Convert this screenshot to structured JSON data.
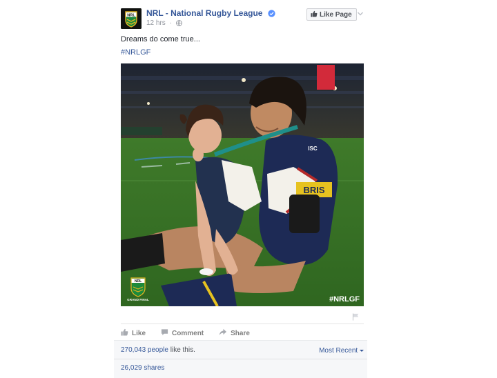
{
  "post": {
    "page_name": "NRL - National Rugby League",
    "timestamp": "12 hrs",
    "like_page_label": "Like Page",
    "text": "Dreams do come true...",
    "hashtag": "#NRLGF",
    "photo": {
      "overlay_tag": "#NRLGF",
      "jersey_text": "BRIS",
      "jersey_brand": "ISC",
      "logo_text": "NRL",
      "event_label": "GRAND FINAL"
    }
  },
  "actions": {
    "like": "Like",
    "comment": "Comment",
    "share": "Share"
  },
  "stats": {
    "likes_count": "270,043 people",
    "likes_suffix": " like this.",
    "sort_label": "Most Recent",
    "shares": "26,029 shares"
  },
  "icons": {
    "verified": "verified-badge-icon",
    "globe": "globe-icon",
    "thumbs_up": "thumbs-up-icon",
    "comment": "comment-icon",
    "share": "share-icon",
    "chevron": "chevron-down-icon",
    "flag": "flag-icon"
  },
  "colors": {
    "link": "#365899",
    "verified": "#5890ff",
    "muted": "#90949c",
    "nrl_green": "#1c8a3b",
    "nrl_gold": "#e6b422"
  }
}
